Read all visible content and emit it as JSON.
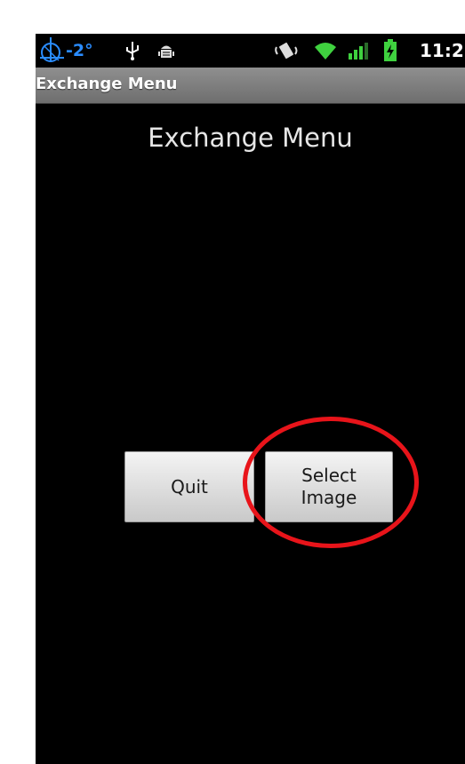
{
  "status_bar": {
    "temperature": "-2°",
    "time": "11:2",
    "icons": [
      "weather-icon",
      "usb-icon",
      "android-debug-icon",
      "vibrate-icon",
      "wifi-icon",
      "signal-icon",
      "battery-charging-icon"
    ],
    "accent_color": "#1e90ff"
  },
  "title_bar": {
    "title": "Exchange Menu"
  },
  "main": {
    "heading": "Exchange Menu",
    "buttons": {
      "quit_label": "Quit",
      "select_label_line1": "Select",
      "select_label_line2": "Image"
    }
  },
  "annotation": {
    "shape": "ellipse",
    "color": "#e8141a",
    "target": "select-image-button"
  }
}
